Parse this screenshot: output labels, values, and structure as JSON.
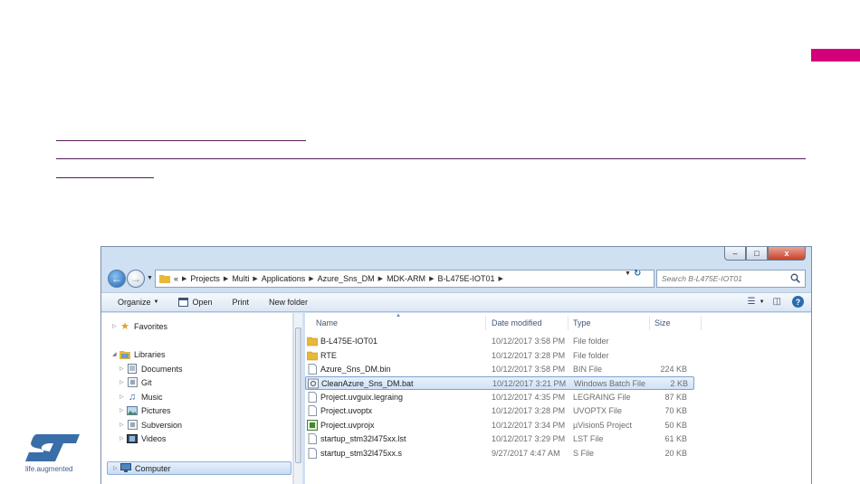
{
  "colors": {
    "accent": "#d4007a",
    "rule": "#5a1a5a",
    "logo": "#3a6ea8",
    "folder": "#e8b838"
  },
  "branding": {
    "tagline": "life.augmented"
  },
  "window": {
    "caption": {
      "minimize": "–",
      "maximize": "□",
      "close": "x"
    },
    "address": {
      "crumbs": [
        "Projects",
        "Multi",
        "Applications",
        "Azure_Sns_DM",
        "MDK-ARM",
        "B-L475E-IOT01"
      ],
      "lead": "«"
    },
    "search": {
      "placeholder": "Search B-L475E-IOT01"
    },
    "toolbar": {
      "organize": "Organize",
      "open": "Open",
      "print": "Print",
      "new_folder": "New folder"
    },
    "nav": {
      "favorites": "Favorites",
      "libraries": "Libraries",
      "documents": "Documents",
      "git": "Git",
      "music": "Music",
      "pictures": "Pictures",
      "subversion": "Subversion",
      "videos": "Videos",
      "computer": "Computer"
    },
    "columns": {
      "name": "Name",
      "date": "Date modified",
      "type": "Type",
      "size": "Size"
    },
    "files": [
      {
        "name": "B-L475E-IOT01",
        "date": "10/12/2017 3:58 PM",
        "type": "File folder",
        "size": "",
        "icon": "folder-icon"
      },
      {
        "name": "RTE",
        "date": "10/12/2017 3:28 PM",
        "type": "File folder",
        "size": "",
        "icon": "folder-icon"
      },
      {
        "name": "Azure_Sns_DM.bin",
        "date": "10/12/2017 3:58 PM",
        "type": "BIN File",
        "size": "224 KB",
        "icon": "file-icon"
      },
      {
        "name": "CleanAzure_Sns_DM.bat",
        "date": "10/12/2017 3:21 PM",
        "type": "Windows Batch File",
        "size": "2 KB",
        "icon": "batch-file-icon"
      },
      {
        "name": "Project.uvguix.legraing",
        "date": "10/12/2017 4:35 PM",
        "type": "LEGRAING File",
        "size": "87 KB",
        "icon": "file-icon"
      },
      {
        "name": "Project.uvoptx",
        "date": "10/12/2017 3:28 PM",
        "type": "UVOPTX File",
        "size": "70 KB",
        "icon": "file-icon"
      },
      {
        "name": "Project.uvprojx",
        "date": "10/12/2017 3:34 PM",
        "type": "µVision5 Project",
        "size": "50 KB",
        "icon": "uvision-project-icon"
      },
      {
        "name": "startup_stm32l475xx.lst",
        "date": "10/12/2017 3:29 PM",
        "type": "LST File",
        "size": "61 KB",
        "icon": "file-icon"
      },
      {
        "name": "startup_stm32l475xx.s",
        "date": "9/27/2017 4:47 AM",
        "type": "S File",
        "size": "20 KB",
        "icon": "file-icon"
      }
    ]
  }
}
